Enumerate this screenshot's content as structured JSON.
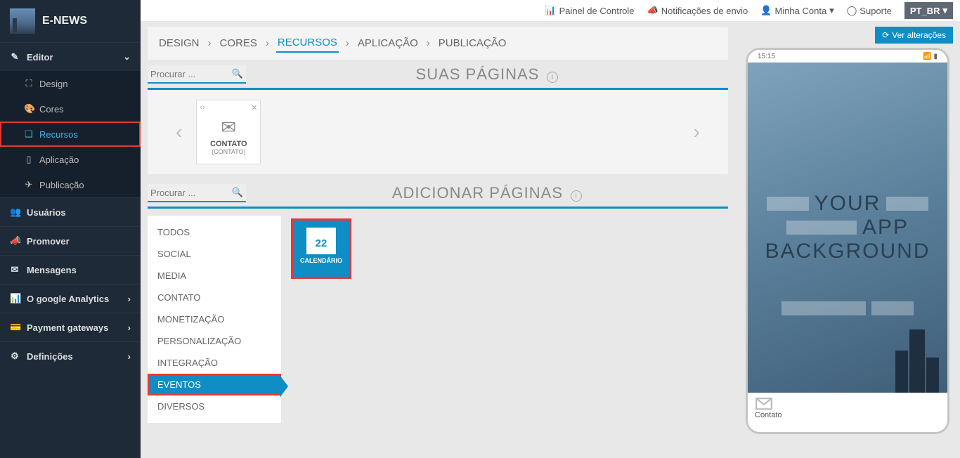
{
  "brand": {
    "title": "E-NEWS"
  },
  "sidebar": {
    "editor": {
      "label": "Editor"
    },
    "design": {
      "label": "Design"
    },
    "cores": {
      "label": "Cores"
    },
    "recursos": {
      "label": "Recursos"
    },
    "aplicacao": {
      "label": "Aplicação"
    },
    "publicacao": {
      "label": "Publicação"
    },
    "usuarios": {
      "label": "Usuários"
    },
    "promover": {
      "label": "Promover"
    },
    "mensagens": {
      "label": "Mensagens"
    },
    "analytics": {
      "label": "O google Analytics"
    },
    "payment": {
      "label": "Payment gateways"
    },
    "definicoes": {
      "label": "Definições"
    }
  },
  "topnav": {
    "painel": "Painel de Controle",
    "notif": "Notificações de envio",
    "conta": "Minha Conta",
    "suporte": "Suporte",
    "lang": "PT_BR"
  },
  "tabs": {
    "design": "DESIGN",
    "cores": "CORES",
    "recursos": "RECURSOS",
    "aplicacao": "APLICAÇÃO",
    "publicacao": "PUBLICAÇÃO"
  },
  "sections": {
    "suas_paginas": "SUAS PÁGINAS",
    "adicionar": "ADICIONAR PÁGINAS"
  },
  "search": {
    "placeholder": "Procurar ..."
  },
  "page_card": {
    "title": "CONTATO",
    "subtitle": "(CONTATO)"
  },
  "categories": {
    "todos": "TODOS",
    "social": "SOCIAL",
    "media": "MEDIA",
    "contato": "CONTATO",
    "monetizacao": "MONETIZAÇÃO",
    "personalizacao": "PERSONALIZAÇÃO",
    "integracao": "INTEGRAÇÃO",
    "eventos": "EVENTOS",
    "diversos": "DIVERSOS"
  },
  "feature": {
    "calendario": {
      "label": "CALENDÁRIO",
      "day": "22"
    }
  },
  "preview": {
    "view_changes": "Ver alterações",
    "time": "15:15",
    "text1": "YOUR",
    "text2": "APP",
    "text3": "BACKGROUND",
    "app_label": "Contato"
  }
}
